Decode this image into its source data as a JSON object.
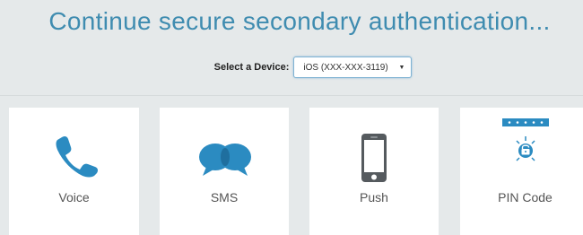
{
  "header": {
    "title": "Continue secure secondary authentication..."
  },
  "device": {
    "label": "Select a Device:",
    "selected": "iOS (XXX-XXX-3119)"
  },
  "methods": [
    {
      "label": "Voice",
      "icon": "phone-icon"
    },
    {
      "label": "SMS",
      "icon": "chat-bubbles-icon"
    },
    {
      "label": "Push",
      "icon": "smartphone-icon"
    },
    {
      "label": "PIN Code",
      "icon": "pin-code-icon"
    }
  ],
  "colors": {
    "accent": "#2b8bc1",
    "title": "#3f8cb0",
    "background": "#e5e9ea",
    "phone_dark": "#555a5e"
  }
}
